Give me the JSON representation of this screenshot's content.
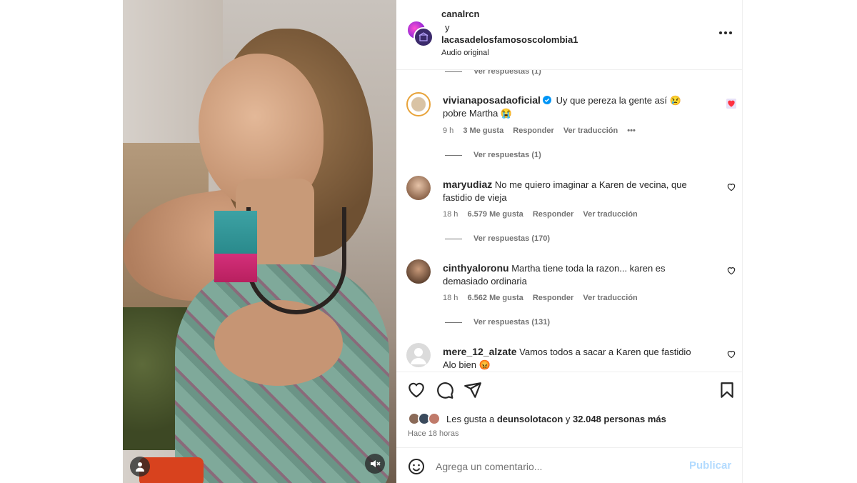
{
  "post": {
    "author1": "canalrcn",
    "and": "y",
    "author2": "lacasadelosfamososcolombia1",
    "audio": "Audio original"
  },
  "comments": [
    {
      "replies_label": "Ver respuestas (1)"
    },
    {
      "username": "vivianaposadaoficial",
      "verified": true,
      "text": "Uy que pereza la gente así 😢",
      "text2": "pobre Martha 😭",
      "time": "9 h",
      "likes": "3 Me gusta",
      "reply": "Responder",
      "translate": "Ver traducción",
      "more": "•••",
      "replies_label": "Ver respuestas (1)",
      "liked": true
    },
    {
      "username": "maryudiaz",
      "text": "No me quiero imaginar a Karen de vecina, que",
      "text2": "fastidio de vieja",
      "time": "18 h",
      "likes": "6.579 Me gusta",
      "reply": "Responder",
      "translate": "Ver traducción",
      "replies_label": "Ver respuestas (170)"
    },
    {
      "username": "cinthyaloronu",
      "text": "Martha tiene toda la razon... karen es",
      "text2": "demasiado ordinaria",
      "time": "18 h",
      "likes": "6.562 Me gusta",
      "reply": "Responder",
      "translate": "Ver traducción",
      "replies_label": "Ver respuestas (131)"
    },
    {
      "username": "mere_12_alzate",
      "text": "Vamos todos a sacar a Karen que fastidio",
      "text2": "Alo bien 😡"
    }
  ],
  "likes_summary": {
    "prefix": "Les gusta a",
    "user": "deunsolotacon",
    "middle": "y",
    "count": "32.048 personas más"
  },
  "posted_time": "Hace 18 horas",
  "add_comment": {
    "placeholder": "Agrega un comentario...",
    "publish_label": "Publicar"
  },
  "colors": {
    "like_red": "#ff3040",
    "link_blue": "#0095f6",
    "publish_disabled": "#b3dbff",
    "secondary_text": "#737373"
  }
}
